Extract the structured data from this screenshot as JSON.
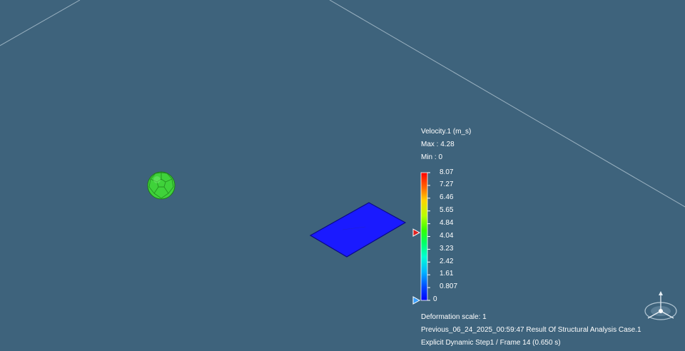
{
  "legend": {
    "title": "Velocity.1 (m_s)",
    "max_text": "Max : 4.28",
    "min_text": "Min : 0",
    "scale_max": 8.07,
    "scale_min": 0,
    "ticks": [
      "8.07",
      "7.27",
      "6.46",
      "5.65",
      "4.84",
      "4.04",
      "3.23",
      "2.42",
      "1.61",
      "0.807",
      "0"
    ],
    "current_max_value": 4.28,
    "current_min_value": 0,
    "max_marker_color": "#e02020",
    "min_marker_color": "#3aa0ff"
  },
  "status": {
    "deformation_scale": "Deformation scale: 1",
    "analysis_case": "Previous_06_24_2025_00:59:47 Result Of Structural Analysis Case.1",
    "frame": "Explicit Dynamic Step1 / Frame 14 (0.650 s)"
  },
  "scene": {
    "background": "#3e637c",
    "ball_color": "#3fd23a",
    "plate_color": "#1a1aff",
    "compass_icon": "3d-axis-compass-icon"
  }
}
